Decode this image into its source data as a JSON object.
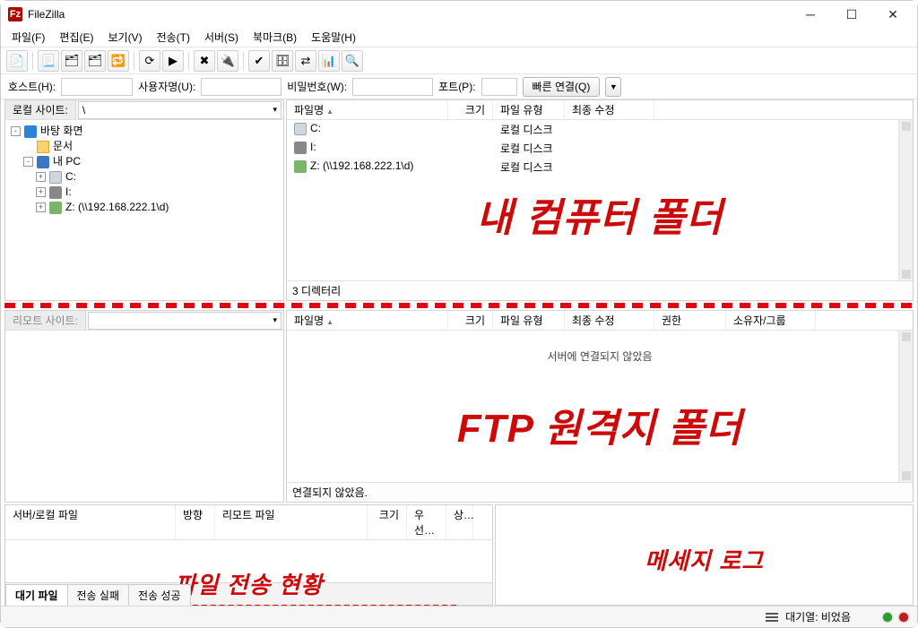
{
  "title": "FileZilla",
  "menu": [
    "파일(F)",
    "편집(E)",
    "보기(V)",
    "전송(T)",
    "서버(S)",
    "북마크(B)",
    "도움말(H)"
  ],
  "toolbar_icons": [
    "site-manager-icon",
    "sep",
    "toggle-log-icon",
    "toggle-tree-local-icon",
    "toggle-tree-remote-icon",
    "toggle-queue-icon",
    "sep",
    "refresh-icon",
    "process-queue-icon",
    "sep",
    "cancel-icon",
    "disconnect-icon",
    "sep",
    "reconnect-icon",
    "filter-icon",
    "compare-icon",
    "sync-browse-icon",
    "find-icon"
  ],
  "icon_glyph": {
    "site-manager-icon": "📄",
    "toggle-log-icon": "📃",
    "toggle-tree-local-icon": "🗂",
    "toggle-tree-remote-icon": "🗂",
    "toggle-queue-icon": "🔁",
    "refresh-icon": "⟳",
    "process-queue-icon": "▶",
    "cancel-icon": "✖",
    "disconnect-icon": "🔌",
    "reconnect-icon": "✔",
    "filter-icon": "🗄",
    "compare-icon": "⇄",
    "sync-browse-icon": "📊",
    "find-icon": "🔍"
  },
  "quickconnect": {
    "host_label": "호스트(H):",
    "user_label": "사용자명(U):",
    "pass_label": "비밀번호(W):",
    "port_label": "포트(P):",
    "button": "빠른 연결(Q)",
    "host": "",
    "user": "",
    "pass": "",
    "port": ""
  },
  "local_site_label": "로컬 사이트:",
  "local_site_path": "\\",
  "local_tree": [
    {
      "indent": 0,
      "exp": "-",
      "icon": "ico-desktop",
      "label": "바탕 화면"
    },
    {
      "indent": 1,
      "exp": "",
      "icon": "ico-folder",
      "label": "문서"
    },
    {
      "indent": 1,
      "exp": "-",
      "icon": "ico-pc",
      "label": "내 PC"
    },
    {
      "indent": 2,
      "exp": "+",
      "icon": "ico-drive",
      "label": "C:"
    },
    {
      "indent": 2,
      "exp": "+",
      "icon": "ico-printer",
      "label": "I:"
    },
    {
      "indent": 2,
      "exp": "+",
      "icon": "ico-net",
      "label": "Z: (\\\\192.168.222.1\\d)"
    }
  ],
  "local_files_head": {
    "name": "파일명",
    "size": "크기",
    "type": "파일 유형",
    "mod": "최종 수정"
  },
  "local_files": [
    {
      "icon": "ico-drive",
      "name": "C:",
      "type": "로컬 디스크"
    },
    {
      "icon": "ico-printer",
      "name": "I:",
      "type": "로컬 디스크"
    },
    {
      "icon": "ico-net",
      "name": "Z: (\\\\192.168.222.1\\d)",
      "type": "로컬 디스크"
    }
  ],
  "local_status": "3 디렉터리",
  "remote_site_label": "리모트 사이트:",
  "remote_files_head": {
    "name": "파일명",
    "size": "크기",
    "type": "파일 유형",
    "mod": "최종 수정",
    "perm": "권한",
    "own": "소유자/그룹"
  },
  "remote_not_connected": "서버에 연결되지 않았음",
  "remote_status": "연결되지 않았음.",
  "queue_head": {
    "file": "서버/로컬 파일",
    "dir": "방향",
    "remote": "리모트 파일",
    "size": "크기",
    "prio": "우선…",
    "stat": "상…"
  },
  "queue_tabs": {
    "active": "대기 파일",
    "failed": "전송 실패",
    "success": "전송 성공"
  },
  "status_queue": "대기열: 비었음",
  "overlays": {
    "local_label": "내 컴퓨터 폴더",
    "remote_label": "FTP 원격지 폴더",
    "queue_label": "파일 전송 현황",
    "log_label": "메세지 로그"
  }
}
